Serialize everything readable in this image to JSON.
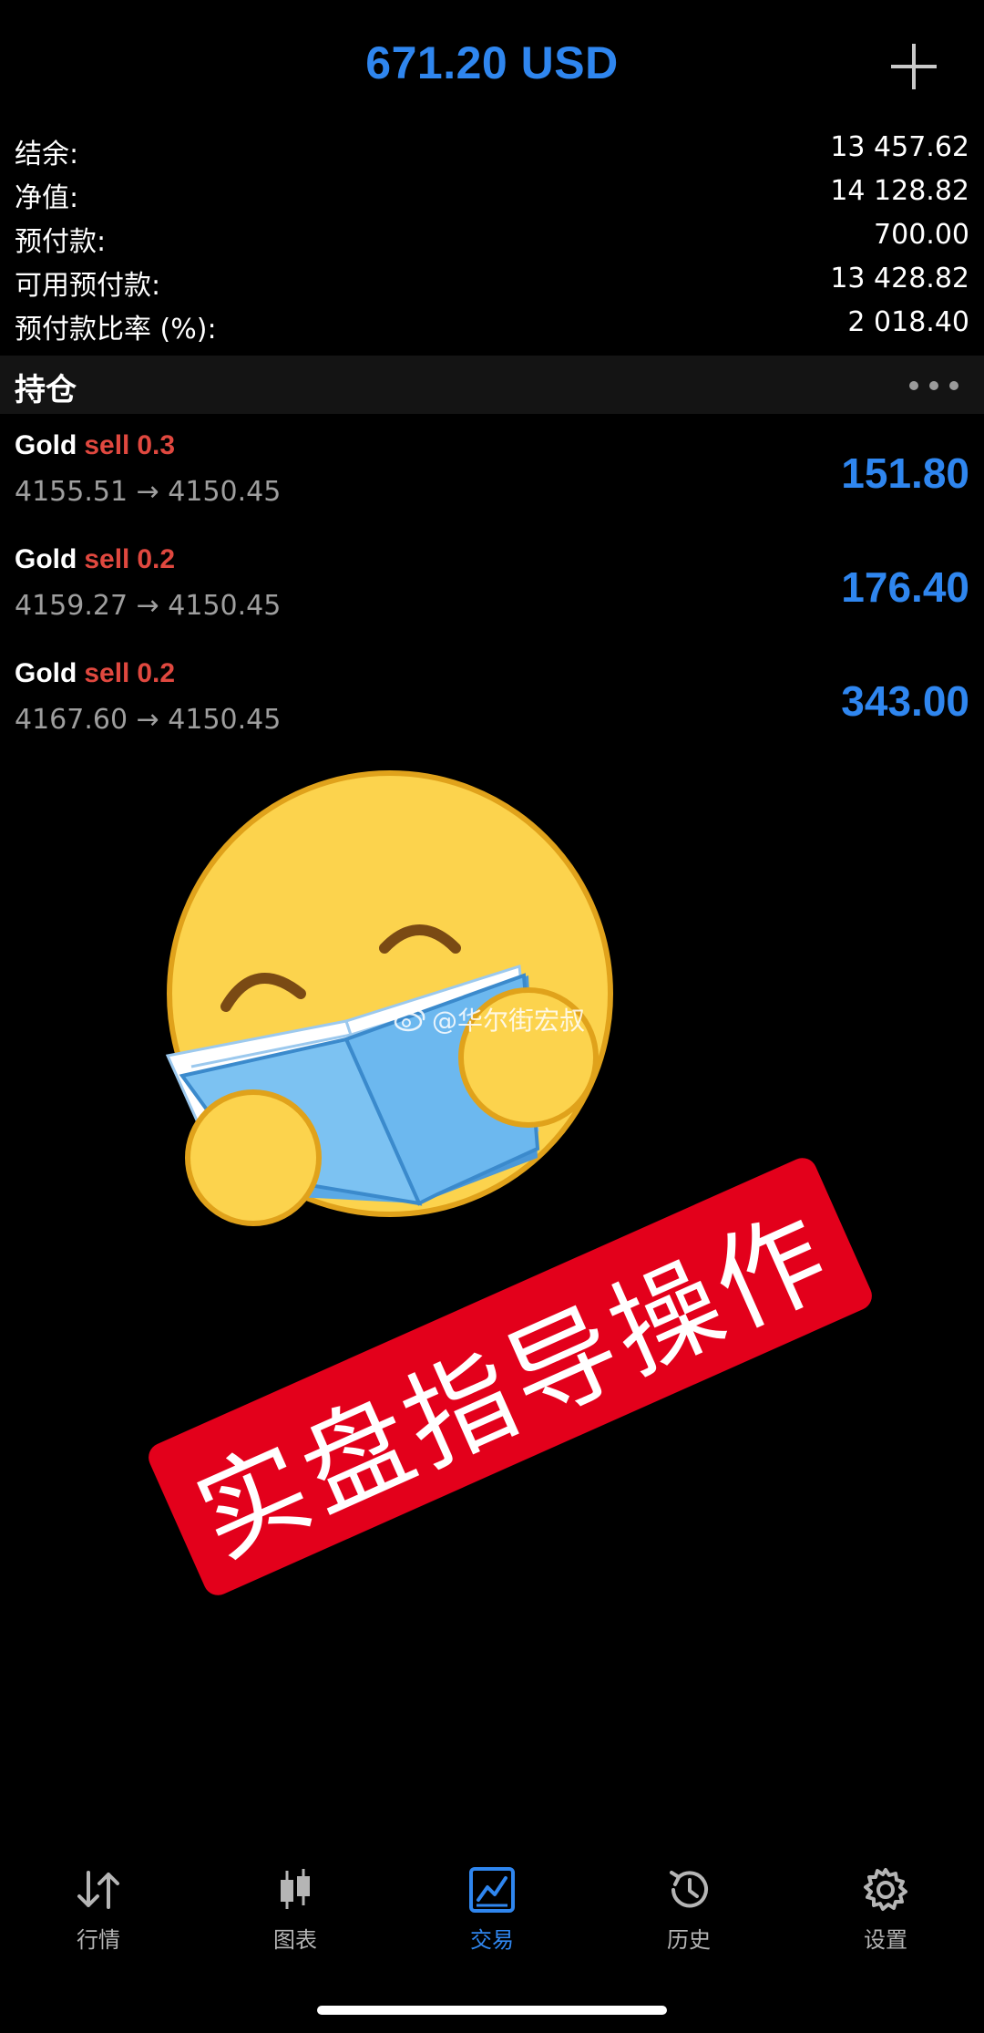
{
  "header": {
    "title": "671.20 USD"
  },
  "summary": [
    {
      "label": "结余:",
      "value": "13 457.62"
    },
    {
      "label": "净值:",
      "value": "14 128.82"
    },
    {
      "label": "预付款:",
      "value": "700.00"
    },
    {
      "label": "可用预付款:",
      "value": "13 428.82"
    },
    {
      "label": "预付款比率 (%):",
      "value": "2 018.40"
    }
  ],
  "positions_section": {
    "title": "持仓"
  },
  "positions": [
    {
      "symbol": "Gold",
      "side": "sell",
      "volume": "0.3",
      "prices": "4155.51 → 4150.45",
      "profit": "151.80"
    },
    {
      "symbol": "Gold",
      "side": "sell",
      "volume": "0.2",
      "prices": "4159.27 → 4150.45",
      "profit": "176.40"
    },
    {
      "symbol": "Gold",
      "side": "sell",
      "volume": "0.2",
      "prices": "4167.60 → 4150.45",
      "profit": "343.00"
    }
  ],
  "overlay": {
    "watermark": "@华尔街宏叔",
    "stamp": "实盘指导操作"
  },
  "nav": [
    {
      "label": "行情",
      "icon": "quotes-arrows-icon",
      "active": false
    },
    {
      "label": "图表",
      "icon": "candlestick-chart-icon",
      "active": false
    },
    {
      "label": "交易",
      "icon": "trade-chart-icon",
      "active": true
    },
    {
      "label": "历史",
      "icon": "history-clock-icon",
      "active": false
    },
    {
      "label": "设置",
      "icon": "settings-gear-icon",
      "active": false
    }
  ],
  "colors": {
    "accent": "#2f86ef",
    "sell": "#e0483f",
    "stamp": "#e3001b"
  }
}
